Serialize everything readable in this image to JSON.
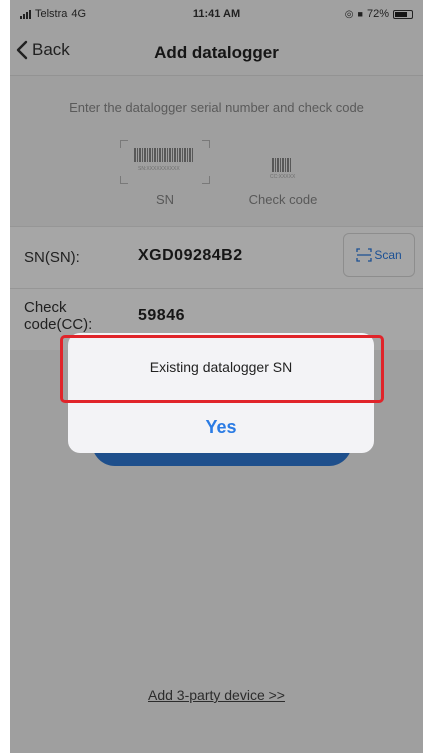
{
  "status_bar": {
    "carrier": "Telstra",
    "network": "4G",
    "time": "11:41 AM",
    "battery": "72%",
    "battery_level": 0.72
  },
  "nav": {
    "back_label": "Back",
    "title": "Add datalogger"
  },
  "instruction": "Enter the datalogger serial number and check code",
  "labels": {
    "sn_caption": "SN",
    "check_caption": "Check code",
    "sn_tiny": "SN:XXXXXXXXXX",
    "cc_tiny": "CC:XXXXX"
  },
  "form": {
    "sn_label": "SN(SN):",
    "sn_value": "XGD09284B2",
    "cc_label": "Check code(CC):",
    "cc_value": "59846",
    "scan_label": "Scan"
  },
  "dialog": {
    "message": "Existing datalogger SN",
    "confirm_label": "Yes"
  },
  "footer_link": "Add 3-party device >>",
  "colors": {
    "accent": "#2a7be4",
    "highlight": "#e0242a"
  }
}
